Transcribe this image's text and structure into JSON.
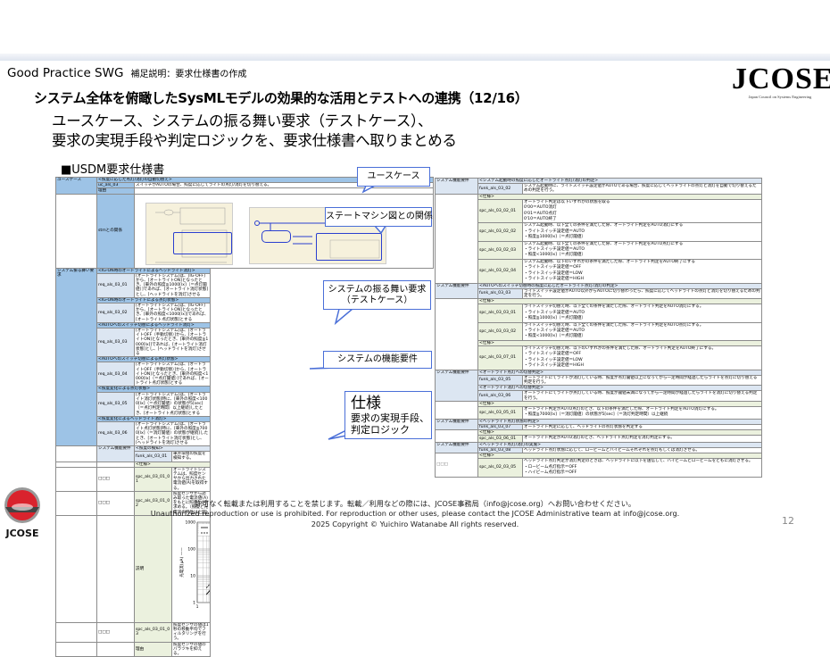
{
  "header": {
    "org": "Good Practice SWG",
    "section": "補足説明：要求仕様書の作成",
    "title": "システム全体を俯瞰したSysMLモデルの効果的な活用とテストへの連携（12/16）",
    "subtitle_lines": [
      "ユースケース、システムの振る舞い要求（テストケース）、",
      "要求の実現手段や判定ロジックを、要求仕様書へ取りまとめる"
    ],
    "section_label": "■USDM要求仕様書"
  },
  "logo": {
    "text": "JCOSE",
    "tagline": "Japan Council on Systems Engineering"
  },
  "bottom_logo": {
    "text": "JCOSE"
  },
  "callouts": {
    "use_case": "ユースケース",
    "stm": "ステートマシン図との関係",
    "behavior_lines": [
      "システムの振る舞い要求",
      "（テストケース）"
    ],
    "function": "システムの機能要件",
    "spec_title": "仕様",
    "spec_lines": [
      "要求の実現手段、",
      "判定ロジック"
    ]
  },
  "left_table": {
    "use_case": {
      "label": "ユースケース",
      "header": "<照度に応じた点灯/消灯の自動切替え>",
      "id": "uc_als_03",
      "text": "スイッチがAUTOの場合、照度に応じてライトの点灯/消灯を切り替える。",
      "reason_label": "理由",
      "reason": ""
    },
    "stm_label": "stmとの関係",
    "behavior": {
      "label": "システム振る舞い要求",
      "items": [
        {
          "header": "<IG-ON時のオートライトによるヘッドライト消灯>",
          "id": "req_als_03_01",
          "text": "[オートライトシステム]は、[IG-OFF]から、[オートライトON]となったとき、[車外の照度≧1000[lx]（＝点灯閾値）]であれば、[オートライト消灯状態]とし、[ヘッドライトを消灯]させる"
        },
        {
          "header": "<IG-ON時のオートライトによる点灯状態>",
          "id": "req_als_03_02",
          "text": "[オートライトシステム]は、[IG-OFF]から、[オートライトON]となったとき、[車外の照度<1000[lx]]であれば、[オートライト点灯状態]とする"
        },
        {
          "header": "<AUTOへのスイッチ切替によるヘッドライト消灯>",
          "id": "req_als_03_03",
          "text": "[オートライトシステム]は、[オートライトOFF（手動切替）]から、[オートライトON]となったとき、[車外の照度≧1000[lx]]であれば、[オートライト消灯状態]とし、[ヘッドライトを消灯]させる"
        },
        {
          "header": "<AUTOへのスイッチ切替による点灯状態>",
          "id": "req_als_03_04",
          "text": "[オートライトシステム]は、[オートライトOFF（手動切替）]から、[オートライトON]となったとき、[車外の照度<1000[lx]（＝点灯閾値）]であれば、[オートライト点灯状態]とする"
        },
        {
          "header": "<照度変化による点灯状態>",
          "id": "req_als_03_05",
          "text": "[オートライトシステム]は、[オートライト消灯状態]時に、[車外の照度<1000[lx]（＝点灯閾値）の状態が5[sec]（＝点灯判定時間）以上継続]したとき、[オートライト点灯状態]とする"
        },
        {
          "header": "<照度変化によるヘッドライト消灯>",
          "id": "req_als_03_06",
          "text": "[オートライトシステム]は、[オートライト点灯状態]時に、[車外の照度≧7000[lx]（＝消灯閾値）の状態が継続]したとき、[オートライト消灯状態]とし、[ヘッドライトを消灯]させる"
        }
      ]
    },
    "function": {
      "label": "システム機能要件",
      "header": "<照度の検知>",
      "id": "funk_als_03_01",
      "text": "車外環境の照度を検知する。",
      "spec_label": "<仕様>",
      "specs": [
        {
          "mark": "□□□",
          "id": "spc_als_03_01_01",
          "text": "オートライトシステムは、照度センサから出力された電流値(A)を取得する。"
        },
        {
          "mark": "□□□",
          "id": "spc_als_03_01_02",
          "text": "照度センサから読み取った電流値(A)をもとに照度(lx)を求める。（照度と光電流の特性は上図）"
        }
      ],
      "explanation_label": "説明",
      "chart": {
        "legend": [
          "平均値",
          "光電流最小値"
        ],
        "xlabel": "照度(lx)",
        "ylabel": "光電流(μA)",
        "x_ticks": [
          "1",
          "10",
          "100",
          "1000",
          "10000"
        ],
        "y_ticks": [
          "1",
          "10",
          "100",
          "1000"
        ]
      },
      "spec_after": {
        "mark": "□□□",
        "id": "spc_als_03_01_03",
        "text": "照度センサの値は1秒の移動平均でフィルタリングを行う。"
      },
      "reason_label": "理由",
      "reason": "照度センサの値のバラツキを抑える。"
    }
  },
  "right_table": {
    "groups": [
      {
        "label": "システム機能要件",
        "mark": "",
        "blocks": [
          {
            "header": "<システム起動時の照度に応じたオートライト点灯/消灯の判定>",
            "id": "funk_als_03_02",
            "text": "システム起動時に、ライトスイッチ設定値がAUTOである場合、照度に応じてヘッドライトの点灯と消灯を自動で切り替えるための判定を行う。"
          }
        ],
        "sections": [
          {
            "label": "<仕様>",
            "items": [
              {
                "id": "spc_als_03_02_01",
                "lines": [
                  "オートライト判定は以下いずれかの状態を取る",
                  "0'00＝AUTO消灯",
                  "0'01＝AUTO点灯",
                  "0'10＝AUTO終了"
                ]
              },
              {
                "id": "spc_als_03_02_02",
                "lines": [
                  "システム起動時、以下全ての条件を満たした際、オートライト判定をAUTO消灯にする",
                  "・ライトスイッチ設定値＝AUTO",
                  "・照度≧1000[lx]（＝点灯閾値）"
                ]
              },
              {
                "id": "spc_als_03_02_03",
                "lines": [
                  "システム起動時、以下全ての条件を満たした際、オートライト判定をAUTO点灯にする",
                  "・ライトスイッチ設定値＝AUTO",
                  "・照度<1000[lx]（＝点灯閾値）"
                ]
              },
              {
                "id": "spc_als_03_02_04",
                "lines": [
                  "システム起動時、以下のいずれかの条件を満たした際、オートライト判定をAUTO終了にする",
                  "・ライトスイッチ設定値＝OFF",
                  "・ライトスイッチ設定値＝LOW",
                  "・ライトスイッチ設定値＝HIGH"
                ]
              }
            ]
          }
        ]
      },
      {
        "label": "システム機能要件",
        "mark": "",
        "blocks": [
          {
            "header": "<AUTOへのスイッチ切替時の照度に応じたオートライト点灯/消灯の判定>",
            "id": "funk_als_03_03",
            "text": "ライトスイッチ設定値がAUTO以外からAUTOに切り替わったら、照度に応じてヘッドライトの点灯と消灯を切り替えるための判定を行う。"
          }
        ],
        "sections": [
          {
            "label": "<仕様>",
            "items": [
              {
                "id": "spc_als_03_03_01",
                "lines": [
                  "ライトスイッチ切替え時、以下全ての条件を満たした際、オートライト判定をAUTO消灯にする。",
                  "・ライトスイッチ設定値＝AUTO",
                  "・照度≧1000[lx]（＝点灯閾値）"
                ]
              },
              {
                "id": "spc_als_03_03_02",
                "lines": [
                  "ライトスイッチ切替え時、以下全ての条件を満たした際、オートライト判定をAUTO点灯にする。",
                  "・ライトスイッチ設定値＝AUTO",
                  "・照度<1000[lx]（＝点灯閾値）"
                ]
              }
            ]
          },
          {
            "label": "<仕様>",
            "items": [
              {
                "id": "spc_als_03_07_01",
                "lines": [
                  "ライトスイッチ切替え時、以下のいずれかの条件を満たした際、オートライト判定をAUTO終了にする。",
                  "・ライトスイッチ設定値＝OFF",
                  "・ライトスイッチ設定値＝LOW",
                  "・ライトスイッチ設定値＝HIGH"
                ]
              }
            ]
          }
        ]
      },
      {
        "label": "システム機能要件",
        "mark": "",
        "blocks": [
          {
            "header": "<オートライト点灯への切替判定>",
            "id": "funk_als_03_05",
            "text": "オートライトにてライトが消灯している時、照度が点灯閾値以上になってから一定時間が経過したらライトを点灯に切り替える判定を行う。"
          },
          {
            "header": "<オートライト消灯への切替判定>",
            "id": "funk_als_03_06",
            "text": "オートライトにてライトが点灯している時、照度が閾値未満になってから一定時間が経過したらライトを消灯に切り替える判定を行う。"
          }
        ],
        "sections": [
          {
            "label": "<仕様>",
            "items": [
              {
                "id": "spc_als_03_05_01",
                "lines": [
                  "オートライト判定がAUTO点灯のとき、以下の条件を満たした際、オートライト判定をAUTO消灯にする。",
                  "・照度≧7000[lx]（＝消灯閾値）の状態が5[sec]（＝消灯判定時間）以上継続"
                ]
              }
            ]
          }
        ]
      },
      {
        "label": "システム機能要件",
        "mark": "",
        "blocks": [
          {
            "header": "<ヘッドライト点灯状態の判定>",
            "id": "funk_als_03_07",
            "text": "オートライト判定に応じて、ヘッドライトの点灯状態を判定する"
          }
        ],
        "sections": [
          {
            "label": "<仕様>",
            "items": [
              {
                "id": "spc_als_03_06_01",
                "lines": [
                  "オートライト判定がAUTO消灯のとき、ヘッドライト点灯判定を消灯判定にする。"
                ]
              }
            ]
          }
        ]
      },
      {
        "label": "システム機能要件",
        "mark": "□□□",
        "blocks": [
          {
            "header": "<ヘッドライト点灯/消灯の実施>",
            "id": "funk_als_03_08",
            "text": "ヘッドライト点灯状態に応じて、ロービームとハイビームそれぞれを点灯もしくは消灯させる。"
          }
        ],
        "sections": [
          {
            "label": "<仕様>",
            "items": [
              {
                "id": "spc_als_02_03_05",
                "lines": [
                  "ヘッドライト点灯判定が消灯判定のときは、ヘッドライトに以下を送信して、ハイビームとロービームをともに消灯させる。",
                  "・ロービーム点灯指示＝OFF",
                  "・ハイビーム点灯指示＝OFF"
                ]
              }
            ]
          }
        ]
      }
    ]
  },
  "footer": {
    "line_ja": "許可なく転載または利用することを禁じます。転載／利用などの際には、JCOSE事務局（info@jcose.org）へお問い合わせください。",
    "line_en": "Unauthorized reproduction or use is prohibited.  For reproduction or other uses, please contact the JCOSE Administrative team at info@jcose.org.",
    "copyright": "2025 Copyright © Yuichiro Watanabe All rights reserved."
  },
  "page_number": "12",
  "colors": {
    "accent_blue": "#4a6fd8",
    "header_blue": "#9dc3e6",
    "light_blue": "#dce6f2",
    "spec_green": "#ebf1de"
  }
}
